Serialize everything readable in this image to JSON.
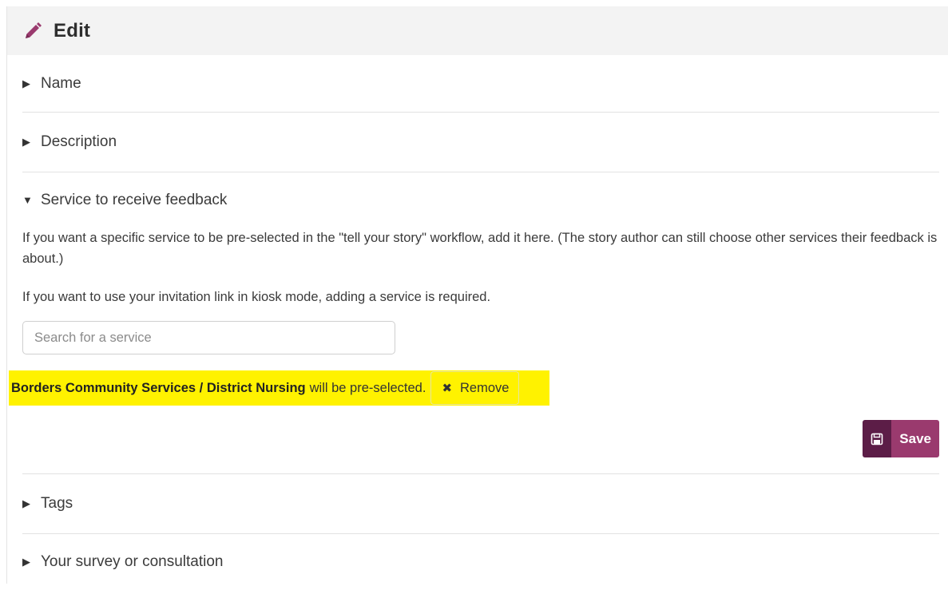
{
  "header": {
    "icon": "pencil-icon",
    "title": "Edit"
  },
  "sections": {
    "name": {
      "arrow": "▶",
      "label": "Name"
    },
    "description": {
      "arrow": "▶",
      "label": "Description"
    },
    "service": {
      "arrow": "▼",
      "label": "Service to receive feedback",
      "help1": "If you want a specific service to be pre-selected in the \"tell your story\" workflow, add it here. (The story author can still choose other services their feedback is about.)",
      "help2": "If you want to use your invitation link in kiosk mode, adding a service is required.",
      "search_placeholder": "Search for a service",
      "search_value": "",
      "selected_service": "Borders Community Services / District Nursing",
      "selected_suffix": "will be pre-selected.",
      "remove_icon": "✖",
      "remove_label": "Remove",
      "save_label": "Save",
      "save_icon": "floppy-disk-icon"
    },
    "tags": {
      "arrow": "▶",
      "label": "Tags"
    },
    "survey": {
      "arrow": "▶",
      "label": "Your survey or consultation"
    }
  },
  "colors": {
    "highlight": "#fff200",
    "save_icon_bg": "#5c1d47",
    "save_label_bg": "#9a3a6e",
    "pencil": "#9a3a6e",
    "header_bg": "#f3f3f3"
  }
}
